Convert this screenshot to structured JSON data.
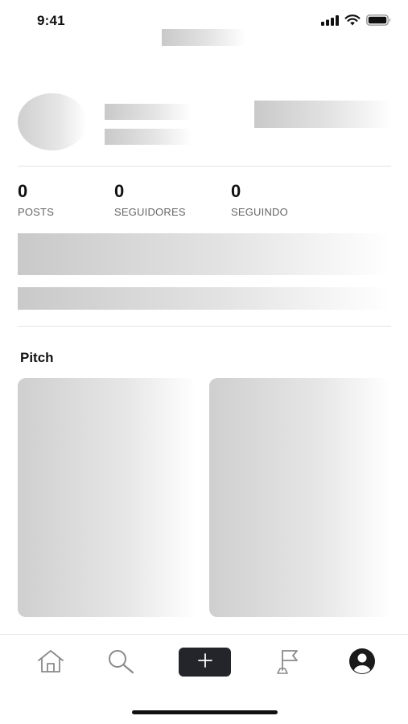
{
  "status_bar": {
    "time": "9:41"
  },
  "stats": [
    {
      "value": "0",
      "label": "POSTS"
    },
    {
      "value": "0",
      "label": "SEGUIDORES"
    },
    {
      "value": "0",
      "label": "SEGUINDO"
    }
  ],
  "section": {
    "title": "Pitch"
  },
  "tab_bar": {
    "items": [
      {
        "icon": "home-icon"
      },
      {
        "icon": "search-icon"
      },
      {
        "icon": "plus-icon"
      },
      {
        "icon": "flag-icon"
      },
      {
        "icon": "profile-icon"
      }
    ]
  },
  "colors": {
    "accent": "#23252b",
    "skeleton": "#c9c9c9",
    "background": "#ffffff"
  }
}
